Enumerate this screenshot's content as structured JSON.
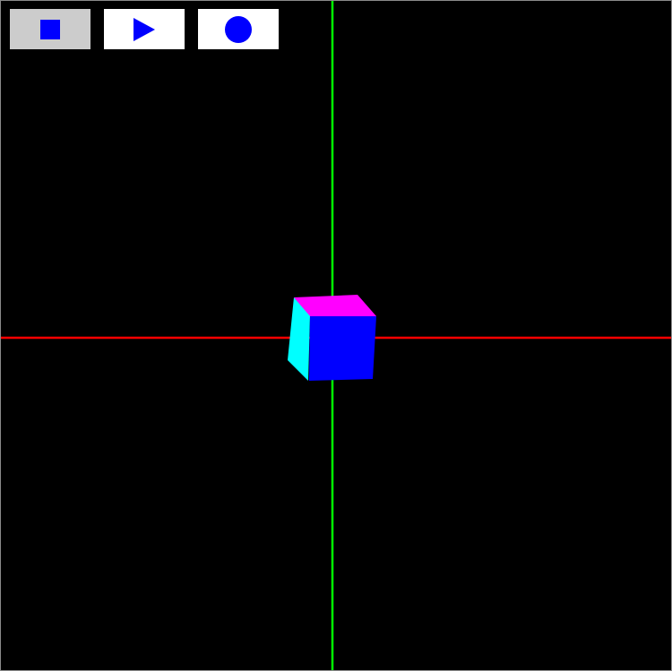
{
  "toolbar": {
    "buttons": [
      {
        "id": "stop",
        "icon": "square-stop-icon",
        "active": true
      },
      {
        "id": "play",
        "icon": "triangle-play-icon",
        "active": false
      },
      {
        "id": "record",
        "icon": "circle-record-icon",
        "active": false
      }
    ],
    "icon_color": "#0000ff",
    "active_background": "#cccccc",
    "inactive_background": "#ffffff"
  },
  "scene": {
    "background": "#000000",
    "x_axis_color": "#ff0000",
    "y_axis_color": "#00ff00",
    "cube": {
      "front_color": "#0000ff",
      "top_color": "#ff00ff",
      "side_color": "#00ffff"
    }
  }
}
